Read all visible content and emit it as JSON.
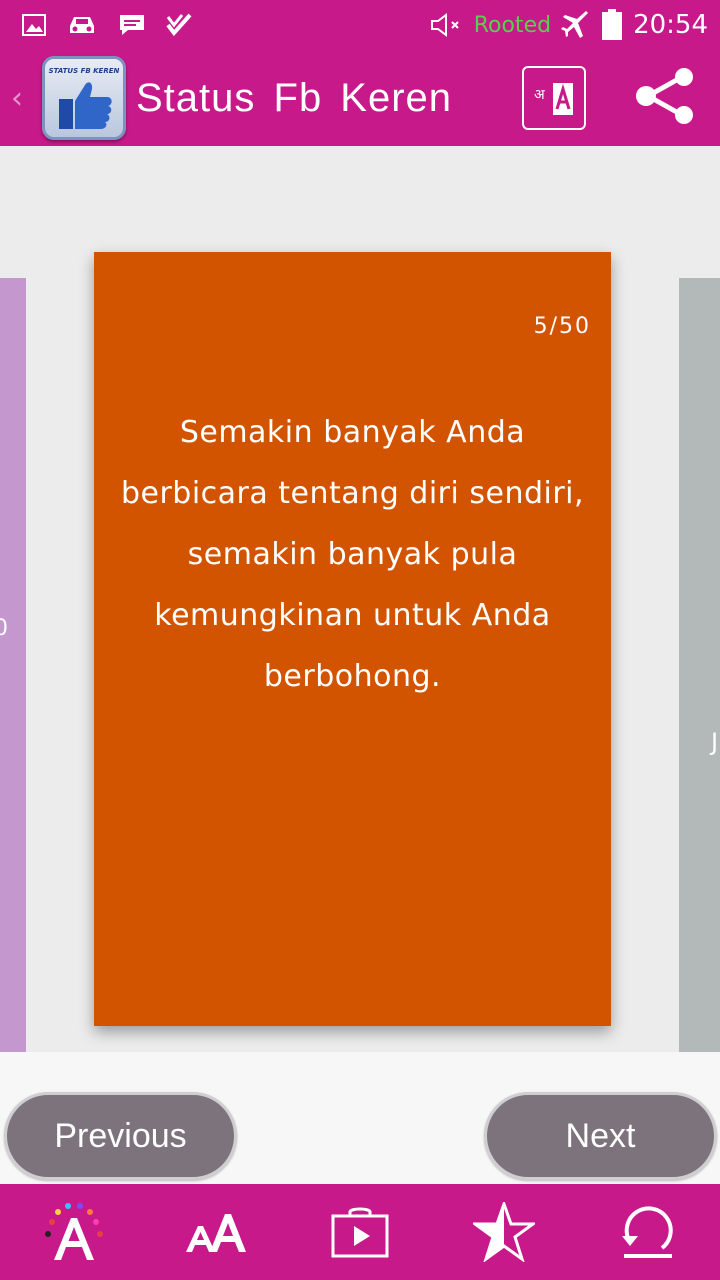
{
  "status_bar": {
    "rooted_label": "Rooted",
    "time": "20:54",
    "icons": [
      "image-icon",
      "car-icon",
      "chat-icon",
      "check-icon",
      "mute-icon",
      "airplane-icon",
      "battery-icon"
    ]
  },
  "app_bar": {
    "title": "Status Fb Keren",
    "logo_text": "STATUS FB KEREN",
    "actions": [
      "translate-icon",
      "share-icon"
    ]
  },
  "card": {
    "counter": "5/50",
    "quote": "Semakin banyak Anda berbicara tentang diri sendiri, semakin banyak pula kemungkinan untuk Anda berbohong.",
    "background": "#d35400"
  },
  "side_cards": {
    "left_color": "#c597cf",
    "left_peek": "0",
    "right_color": "#b3b8b8",
    "right_peek": "J"
  },
  "navigation": {
    "previous_label": "Previous",
    "next_label": "Next"
  },
  "bottom_bar": {
    "items": [
      "colors-icon",
      "font-size-icon",
      "play-store-icon",
      "rate-star-icon",
      "refresh-icon"
    ]
  },
  "colors": {
    "primary": "#c8198a",
    "button": "#7d737c"
  }
}
